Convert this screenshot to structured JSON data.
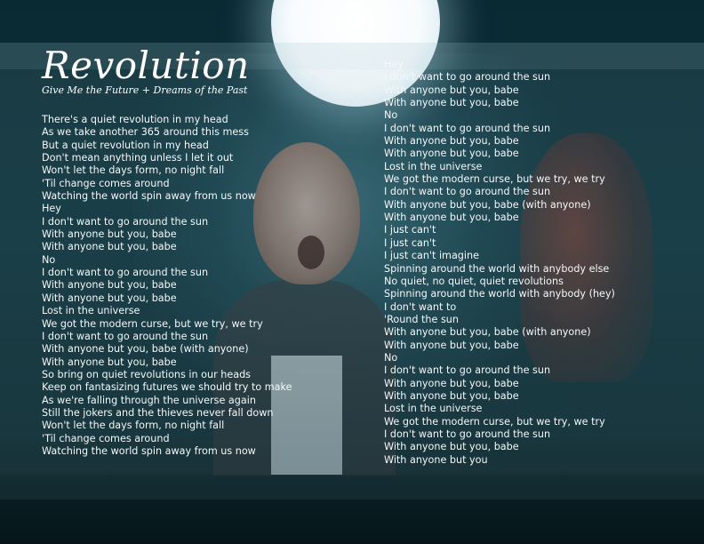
{
  "title": "Revolution",
  "subtitle": "Give Me the Future + Dreams of the Past",
  "colors": {
    "background": "#0b2f38",
    "text": "#ffffff"
  },
  "lyrics_left": [
    "There's a quiet revolution in my head",
    "As we take another 365 around this mess",
    "But a quiet revolution in my head",
    "Don't mean anything unless I let it out",
    "Won't let the days form, no night fall",
    "'Til change comes around",
    "Watching the world spin away from us now",
    "Hey",
    "I don't want to go around the sun",
    "With anyone but you, babe",
    "With anyone but you, babe",
    "No",
    "I don't want to go around the sun",
    "With anyone but you, babe",
    "With anyone but you, babe",
    "Lost in the universe",
    "We got the modern curse, but we try, we try",
    "I don't want to go around the sun",
    "With anyone but you, babe (with anyone)",
    "With anyone but you, babe",
    "So bring on quiet revolutions in our heads",
    "Keep on fantasizing futures we should try to make",
    "As we're falling through the universe again",
    "Still the jokers and the thieves never fall down",
    "Won't let the days form, no night fall",
    "'Til change comes around",
    "Watching the world spin away from us now"
  ],
  "lyrics_right": [
    "Hey",
    "I don't want to go around the sun",
    "With anyone but you, babe",
    "With anyone but you, babe",
    "No",
    "I don't want to go around the sun",
    "With anyone but you, babe",
    "With anyone but you, babe",
    "Lost in the universe",
    "We got the modern curse, but we try, we try",
    "I don't want to go around the sun",
    "With anyone but you, babe (with anyone)",
    "With anyone but you, babe",
    "I just can't",
    "I just can't",
    "I just can't imagine",
    "Spinning around the world with anybody else",
    "No quiet, no quiet, quiet revolutions",
    "Spinning around the world with anybody (hey)",
    "I don't want to",
    "'Round the sun",
    "With anyone but you, babe (with anyone)",
    "With anyone but you, babe",
    "No",
    "I don't want to go around the sun",
    "With anyone but you, babe",
    "With anyone but you, babe",
    "Lost in the universe",
    "We got the modern curse, but we try, we try",
    "I don't want to go around the sun",
    "With anyone but you, babe",
    "With anyone but you"
  ]
}
